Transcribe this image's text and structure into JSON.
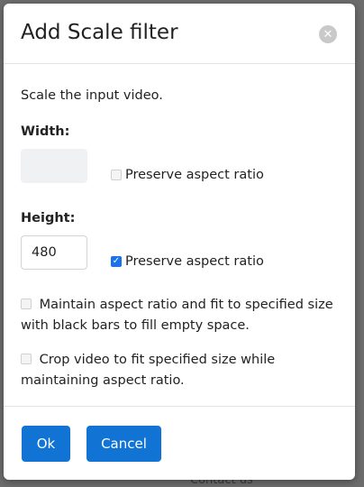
{
  "backdrop": {
    "partial_text": "Contact us"
  },
  "dialog": {
    "title": "Add Scale filter",
    "close_icon": "close-circle-icon",
    "description": "Scale the input video.",
    "width": {
      "label": "Width:",
      "value": "",
      "preserve_aspect_label": "Preserve aspect ratio",
      "preserve_aspect_checked": false
    },
    "height": {
      "label": "Height:",
      "value": "480",
      "preserve_aspect_label": "Preserve aspect ratio",
      "preserve_aspect_checked": true
    },
    "maintain_fit": {
      "label": "Maintain aspect ratio and fit to specified size with black bars to fill empty space.",
      "checked": false,
      "disabled": true
    },
    "crop_fit": {
      "label": "Crop video to fit specified size while maintaining aspect ratio.",
      "checked": false,
      "disabled": true
    },
    "buttons": {
      "ok": "Ok",
      "cancel": "Cancel"
    }
  },
  "colors": {
    "primary_button": "#1173d4",
    "checkbox_checked": "#1a73e8",
    "backdrop": "#6c6c6c"
  }
}
